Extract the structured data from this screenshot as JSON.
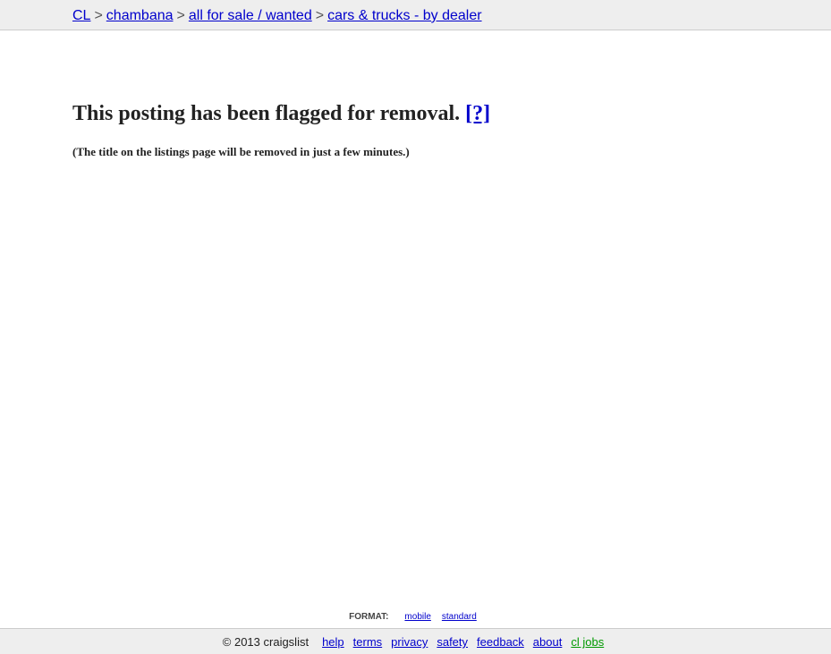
{
  "breadcrumb": {
    "items": [
      "CL",
      "chambana",
      "all for sale / wanted",
      "cars & trucks - by dealer"
    ],
    "separator": ">"
  },
  "main": {
    "heading": "This posting has been flagged for removal.",
    "help_link": "[?]",
    "note": "(The title on the listings page will be removed in just a few minutes.)"
  },
  "format": {
    "label": "FORMAT:",
    "options": [
      "mobile",
      "standard"
    ]
  },
  "footer": {
    "copyright": "© 2013 craigslist",
    "links": [
      "help",
      "terms",
      "privacy",
      "safety",
      "feedback",
      "about",
      "cl jobs"
    ]
  },
  "colors": {
    "link": "#0000cc",
    "jobs_link": "#009900",
    "bar_background": "#eeeeee",
    "text": "#222222"
  }
}
